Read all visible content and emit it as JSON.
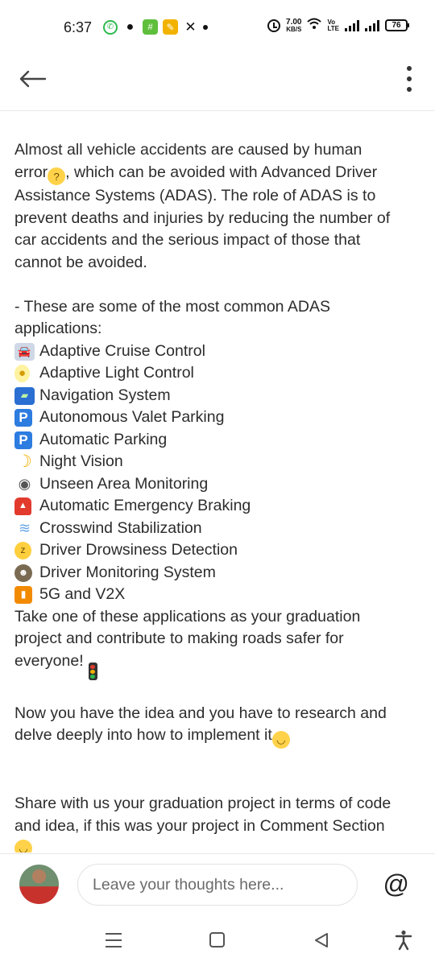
{
  "status_bar": {
    "time": "6:37",
    "speed_value": "7.00",
    "speed_unit": "KB/S",
    "volte_top": "Vo",
    "volte_bottom": "LTE",
    "battery": "76"
  },
  "app_bar": {
    "back_icon": "arrow-left-icon",
    "more_icon": "more-vert-icon"
  },
  "post": {
    "intro_lines": [
      "Almost all vehicle accidents are caused by human",
      "error",
      ", which can be avoided with Advanced Driver",
      "Assistance Systems (ADAS). The role of ADAS is to",
      "prevent deaths and injuries by reducing the number of",
      "car accidents and the serious impact of those that",
      "cannot be avoided."
    ],
    "list_heading_lines": [
      "- These are some of the most common ADAS",
      "applications:"
    ],
    "applications": [
      {
        "icon": "car-icon",
        "label": "Adaptive Cruise Control"
      },
      {
        "icon": "light-bulb-icon",
        "label": "Adaptive Light Control"
      },
      {
        "icon": "map-icon",
        "label": "Navigation System"
      },
      {
        "icon": "parking-icon",
        "label": "Autonomous Valet Parking"
      },
      {
        "icon": "parking-icon",
        "label": "Automatic Parking"
      },
      {
        "icon": "moon-icon",
        "label": "Night Vision"
      },
      {
        "icon": "eye-icon",
        "label": "Unseen Area Monitoring"
      },
      {
        "icon": "siren-icon",
        "label": "Automatic Emergency Braking"
      },
      {
        "icon": "wind-icon",
        "label": "Crosswind Stabilization"
      },
      {
        "icon": "sleepy-face-icon",
        "label": "Driver Drowsiness Detection"
      },
      {
        "icon": "detective-icon",
        "label": "Driver Monitoring System"
      },
      {
        "icon": "signal-bars-icon",
        "label": "5G and V2X"
      }
    ],
    "take_lines": [
      "Take one of these applications as your graduation",
      "project and contribute to making roads safer for",
      "everyone!"
    ],
    "idea_lines": [
      "Now you have the idea and you have to research and",
      "delve deeply into how to implement it"
    ],
    "share_lines": [
      "Share with us your graduation project in terms of code",
      "and idea, if this was your project in Comment Section"
    ]
  },
  "comment_bar": {
    "placeholder": "Leave your thoughts here...",
    "mention_label": "@"
  },
  "nav_bar": {
    "icons": [
      "recents-icon",
      "home-icon",
      "back-icon",
      "accessibility-icon"
    ]
  }
}
